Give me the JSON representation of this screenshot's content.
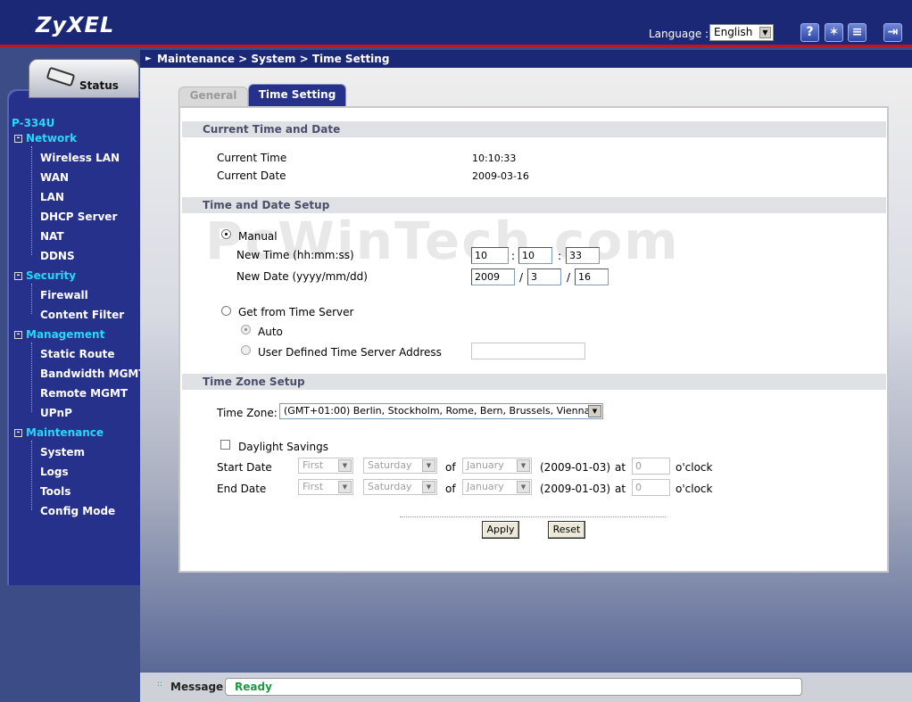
{
  "header": {
    "brand": "ZyXEL",
    "language_label": "Language :",
    "language_value": "English",
    "icons": [
      "help-icon",
      "wizard-icon",
      "sitemap-icon",
      "logout-icon"
    ]
  },
  "sidebar": {
    "status_tab": "Status",
    "device": "P-334U",
    "groups": [
      {
        "label": "Network",
        "items": [
          "Wireless LAN",
          "WAN",
          "LAN",
          "DHCP Server",
          "NAT",
          "DDNS"
        ]
      },
      {
        "label": "Security",
        "items": [
          "Firewall",
          "Content Filter"
        ]
      },
      {
        "label": "Management",
        "items": [
          "Static Route",
          "Bandwidth MGMT",
          "Remote MGMT",
          "UPnP"
        ]
      },
      {
        "label": "Maintenance",
        "items": [
          "System",
          "Logs",
          "Tools",
          "Config Mode"
        ]
      }
    ]
  },
  "breadcrumb": "Maintenance > System > Time Setting",
  "tabs": {
    "general": "General",
    "time_setting": "Time Setting"
  },
  "watermark": "PcWinTech.com",
  "current": {
    "section_title": "Current Time and Date",
    "time_label": "Current Time",
    "time_value": "10:10:33",
    "date_label": "Current Date",
    "date_value": "2009-03-16"
  },
  "setup": {
    "section_title": "Time and Date Setup",
    "manual_label": "Manual",
    "new_time_label": "New Time (hh:mm:ss)",
    "hh": "10",
    "mm": "10",
    "ss": "33",
    "time_sep": ":",
    "new_date_label": "New Date (yyyy/mm/dd)",
    "yyyy": "2009",
    "mo": "3",
    "dd": "16",
    "date_sep": "/",
    "server_label": "Get from Time Server",
    "auto_label": "Auto",
    "user_defined_label": "User Defined Time Server Address",
    "server_address": ""
  },
  "timezone": {
    "section_title": "Time Zone Setup",
    "label": "Time Zone:",
    "value": "(GMT+01:00) Berlin, Stockholm, Rome, Bern, Brussels, Vienna",
    "daylight_label": "Daylight Savings",
    "start_label": "Start Date",
    "end_label": "End Date",
    "start": {
      "week": "First",
      "day": "Saturday",
      "month": "January",
      "date": "(2009-01-03)",
      "hour": "0"
    },
    "end": {
      "week": "First",
      "day": "Saturday",
      "month": "January",
      "date": "(2009-01-03)",
      "hour": "0"
    },
    "of_label": "of",
    "at_label": "at",
    "oclock_label": "o'clock"
  },
  "buttons": {
    "apply": "Apply",
    "reset": "Reset"
  },
  "message": {
    "label": "Message",
    "value": "Ready"
  },
  "colors": {
    "header_blue": "#1b2876",
    "nav_cyan": "#27d8f7",
    "status_green": "#1c9a41",
    "accent_red": "#c4141c"
  }
}
